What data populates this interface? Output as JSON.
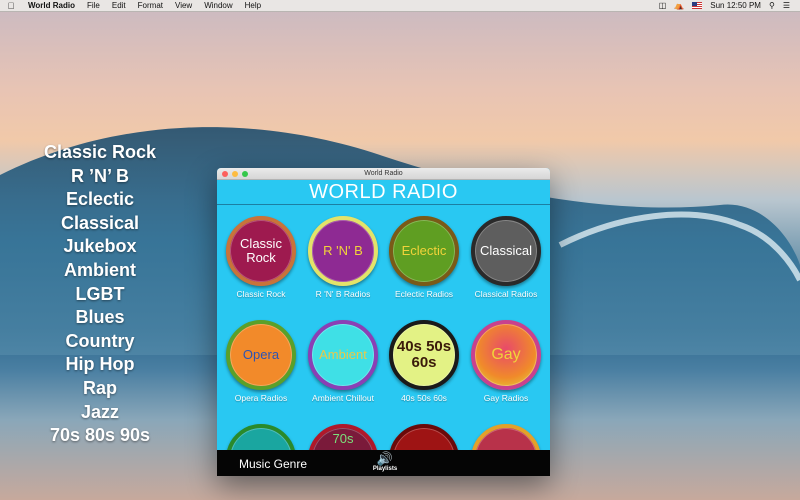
{
  "menubar": {
    "app_name": "World Radio",
    "menus": [
      "File",
      "Edit",
      "Format",
      "View",
      "Window",
      "Help"
    ],
    "clock": "Sun 12:50 PM"
  },
  "genre_list": [
    "Classic Rock",
    "R ’N’ B",
    "Eclectic",
    "Classical",
    "Jukebox",
    "Ambient",
    "LGBT",
    "Blues",
    "Country",
    "Hip Hop",
    "Rap",
    "Jazz",
    "70s 80s 90s"
  ],
  "window": {
    "title": "World Radio",
    "header": "WORLD RADIO"
  },
  "stations": [
    {
      "disc_text": "Classic Rock",
      "caption": "Classic Rock",
      "fill": "#9e1a4f",
      "ring": "#c8733a",
      "text_color": "#ffffff"
    },
    {
      "disc_text": "R 'N' B",
      "caption": "R 'N' B Radios",
      "fill": "#8e2a93",
      "ring": "#e3e36a",
      "text_color": "#f1d33a"
    },
    {
      "disc_text": "Eclectic",
      "caption": "Eclectic Radios",
      "fill": "#5f9e22",
      "ring": "#7a5a18",
      "text_color": "#f1d33a"
    },
    {
      "disc_text": "Classical",
      "caption": "Classical Radios",
      "fill": "#5e5e5e",
      "ring": "#2a2a2a",
      "text_color": "#ffffff"
    },
    {
      "disc_text": "Opera",
      "caption": "Opera Radios",
      "fill": "#f28a2a",
      "ring": "#5aa02a",
      "text_color": "#2b54b4"
    },
    {
      "disc_text": "Ambient",
      "caption": "Ambient Chillout",
      "fill": "#3fe0e6",
      "ring": "#8b3fb5",
      "text_color": "#e9c94a"
    },
    {
      "disc_text": "40s 50s 60s",
      "caption": "40s 50s 60s",
      "fill": "#e3f285",
      "ring": "#1a1a1a",
      "text_color": "#3a1a0a"
    },
    {
      "disc_text": "Gay",
      "caption": "Gay Radios",
      "fill": "#e84a8a",
      "ring": "#c8418e",
      "text_color": "#f1d33a"
    },
    {
      "disc_text": "",
      "caption": "",
      "fill": "#1aa6a0",
      "ring": "#2a8a2a",
      "text_color": "#ffffff"
    },
    {
      "disc_text": "70s",
      "caption": "",
      "fill": "#7a1a3a",
      "ring": "#b0182a",
      "text_color": "#7be07b"
    },
    {
      "disc_text": "",
      "caption": "",
      "fill": "#9e1414",
      "ring": "#6a0a0a",
      "text_color": "#ffffff"
    },
    {
      "disc_text": "",
      "caption": "",
      "fill": "#b8324a",
      "ring": "#e3a12a",
      "text_color": "#ffffff"
    }
  ],
  "footer": {
    "genre_tab": "Music Genre",
    "playlists_tab": "Playlists"
  }
}
